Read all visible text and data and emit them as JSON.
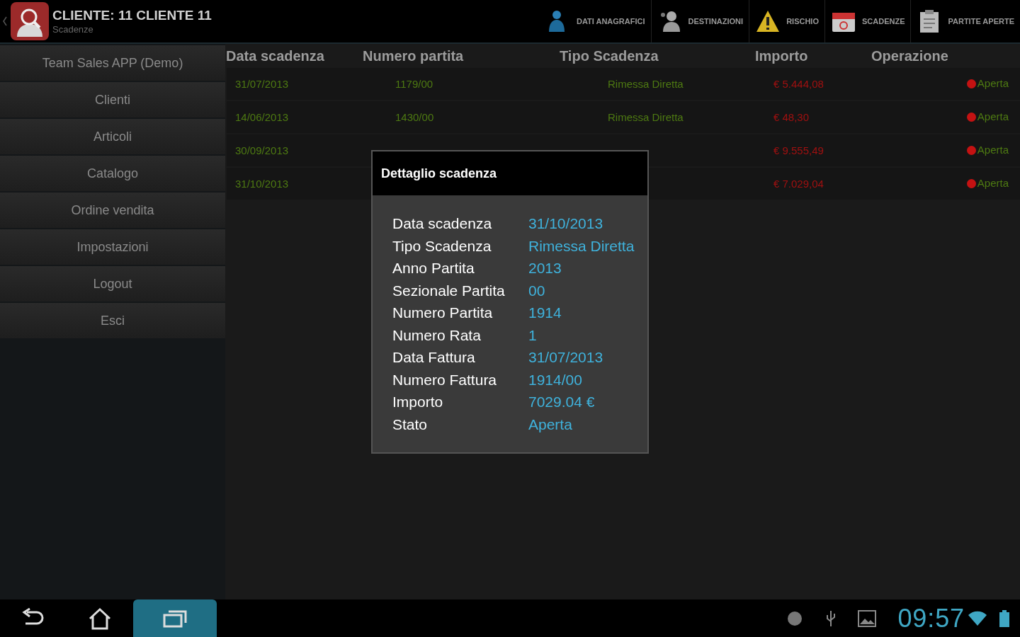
{
  "header": {
    "title": "CLIENTE: 11 CLIENTE 11",
    "subtitle": "Scadenze",
    "actions": [
      {
        "label": "DATI ANAGRAFICI"
      },
      {
        "label": "DESTINAZIONI"
      },
      {
        "label": "RISCHIO"
      },
      {
        "label": "SCADENZE"
      },
      {
        "label": "PARTITE APERTE"
      }
    ]
  },
  "sidebar": {
    "items": [
      {
        "label": "Team Sales APP (Demo)"
      },
      {
        "label": "Clienti"
      },
      {
        "label": "Articoli"
      },
      {
        "label": "Catalogo"
      },
      {
        "label": "Ordine vendita"
      },
      {
        "label": "Impostazioni"
      },
      {
        "label": "Logout"
      },
      {
        "label": "Esci"
      }
    ]
  },
  "table": {
    "columns": [
      "Data scadenza",
      "Numero partita",
      "Tipo Scadenza",
      "Importo",
      "Operazione"
    ],
    "rows": [
      {
        "data": "31/07/2013",
        "numero": "1179/00",
        "tipo": "Rimessa Diretta",
        "importo": "€ 5.444,08",
        "operazione": "Aperta"
      },
      {
        "data": "14/06/2013",
        "numero": "1430/00",
        "tipo": "Rimessa Diretta",
        "importo": "€ 48,30",
        "operazione": "Aperta"
      },
      {
        "data": "30/09/2013",
        "importo": "€ 9.555,49",
        "operazione": "Aperta"
      },
      {
        "data": "31/10/2013",
        "importo": "€ 7.029,04",
        "operazione": "Aperta"
      }
    ]
  },
  "dialog": {
    "title": "Dettaglio scadenza",
    "fields": [
      {
        "label": "Data scadenza",
        "value": "31/10/2013"
      },
      {
        "label": "Tipo Scadenza",
        "value": "Rimessa Diretta"
      },
      {
        "label": "Anno Partita",
        "value": "2013"
      },
      {
        "label": "Sezionale Partita",
        "value": "00"
      },
      {
        "label": "Numero Partita",
        "value": "1914"
      },
      {
        "label": "Numero Rata",
        "value": "1"
      },
      {
        "label": "Data Fattura",
        "value": "31/07/2013"
      },
      {
        "label": "Numero Fattura",
        "value": "1914/00"
      },
      {
        "label": "Importo",
        "value": "7029.04 €"
      },
      {
        "label": "Stato",
        "value": "Aperta"
      }
    ]
  },
  "system_bar": {
    "time": "09:57"
  }
}
